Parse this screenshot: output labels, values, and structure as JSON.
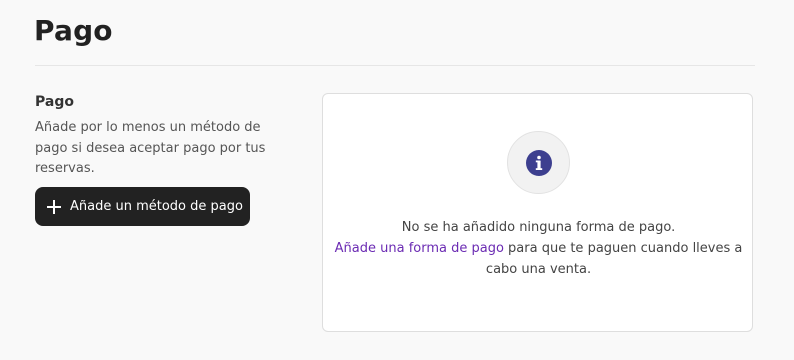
{
  "page": {
    "title": "Pago"
  },
  "section": {
    "heading": "Pago",
    "description": "Añade por lo menos un método de pago si desea aceptar pago por tus reservas.",
    "add_button_label": "Añade un método de pago",
    "add_button_icon": "plus-icon"
  },
  "empty_state": {
    "icon": "info-icon",
    "line1": "No se ha añadido ninguna forma de pago.",
    "link_text": "Añade una forma de pago",
    "line2_rest": " para que te paguen cuando lleves a cabo una venta."
  },
  "colors": {
    "button_bg": "#222222",
    "link": "#6b2bb3",
    "info_icon": "#3d3f8f"
  }
}
